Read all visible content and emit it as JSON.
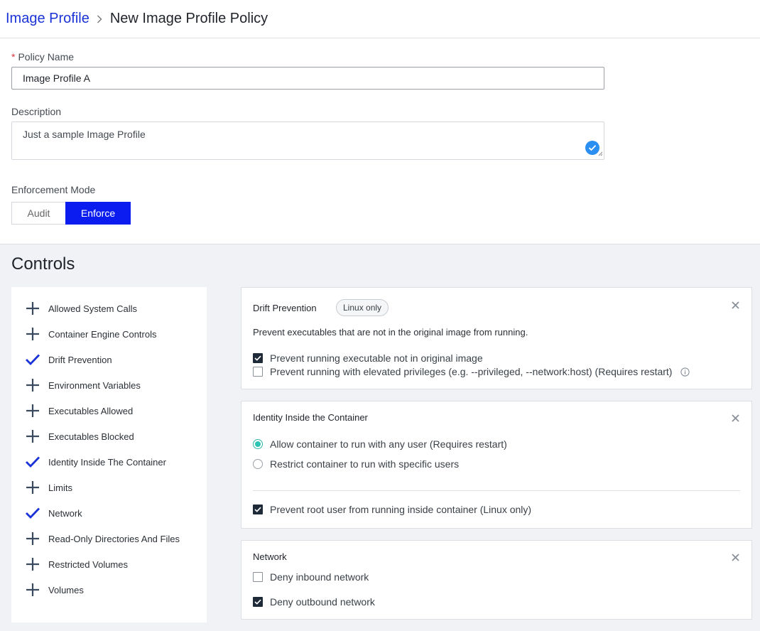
{
  "breadcrumb": {
    "parent": "Image Profile",
    "current": "New Image Profile Policy"
  },
  "form": {
    "policy_name_label": "Policy Name",
    "policy_name_value": "Image Profile A",
    "description_label": "Description",
    "description_value": "Just a sample Image Profile",
    "enforcement_label": "Enforcement Mode",
    "mode_audit": "Audit",
    "mode_enforce": "Enforce",
    "mode_selected": "Enforce"
  },
  "controls": {
    "title": "Controls",
    "items": [
      {
        "label": "Allowed System Calls",
        "icon": "plus-icon"
      },
      {
        "label": "Container Engine Controls",
        "icon": "plus-icon"
      },
      {
        "label": "Drift Prevention",
        "icon": "check-icon"
      },
      {
        "label": "Environment Variables",
        "icon": "plus-icon"
      },
      {
        "label": "Executables Allowed",
        "icon": "plus-icon"
      },
      {
        "label": "Executables Blocked",
        "icon": "plus-icon"
      },
      {
        "label": "Identity Inside The Container",
        "icon": "check-icon"
      },
      {
        "label": "Limits",
        "icon": "plus-icon"
      },
      {
        "label": "Network",
        "icon": "check-icon"
      },
      {
        "label": "Read-Only Directories And Files",
        "icon": "plus-icon"
      },
      {
        "label": "Restricted Volumes",
        "icon": "plus-icon"
      },
      {
        "label": "Volumes",
        "icon": "plus-icon"
      }
    ]
  },
  "drift": {
    "title": "Drift Prevention",
    "badge": "Linux only",
    "description": "Prevent executables that are not in the original image from running.",
    "opt1": "Prevent running executable not in original image",
    "opt1_checked": true,
    "opt2": "Prevent running with elevated privileges (e.g. --privileged, --network:host) (Requires restart)",
    "opt2_checked": false
  },
  "identity": {
    "title": "Identity Inside the Container",
    "radio1": "Allow container to run with any user (Requires restart)",
    "radio2": "Restrict container to run with specific users",
    "selected": "radio1",
    "check1": "Prevent root user from running inside container (Linux only)",
    "check1_checked": true
  },
  "network": {
    "title": "Network",
    "opt1": "Deny inbound network",
    "opt1_checked": false,
    "opt2": "Deny outbound network",
    "opt2_checked": true
  },
  "colors": {
    "accent": "#0a1cf0",
    "link": "#1a33d6",
    "radio": "#2bc4b3",
    "check_icon": "#1a33d6",
    "plus_icon": "#3a4a5e"
  }
}
